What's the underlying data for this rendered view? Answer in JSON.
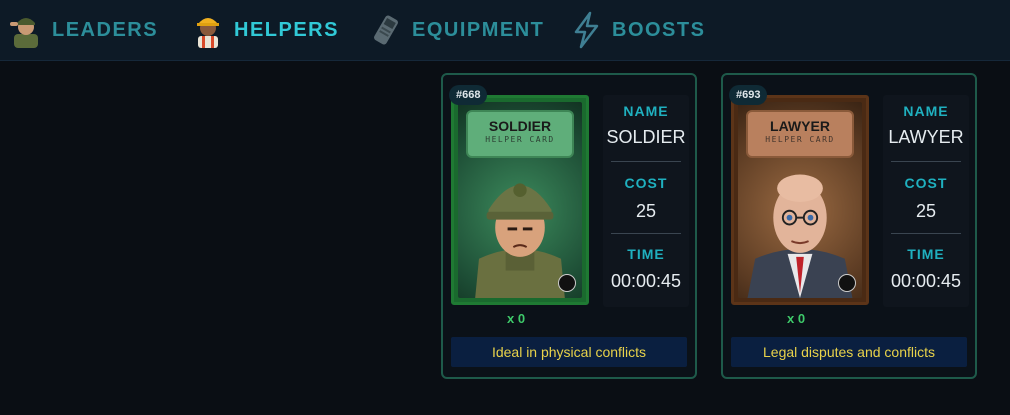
{
  "tabs": [
    {
      "label": "LEADERS",
      "icon": "soldier-leader-icon",
      "active": false
    },
    {
      "label": "HELPERS",
      "icon": "worker-helper-icon",
      "active": true
    },
    {
      "label": "EQUIPMENT",
      "icon": "phone-device-icon",
      "active": false
    },
    {
      "label": "BOOSTS",
      "icon": "lightning-bolt-icon",
      "active": false
    }
  ],
  "cards": [
    {
      "id_label": "#668",
      "art_title": "SOLDIER",
      "art_subtitle": "HELPER CARD",
      "theme": "green",
      "fields": {
        "name_key": "NAME",
        "name_value": "SOLDIER",
        "cost_key": "COST",
        "cost_value": "25",
        "time_key": "TIME",
        "time_value": "00:00:45"
      },
      "quantity": "x 0",
      "description": "Ideal in physical conflicts"
    },
    {
      "id_label": "#693",
      "art_title": "LAWYER",
      "art_subtitle": "HELPER CARD",
      "theme": "brown",
      "fields": {
        "name_key": "NAME",
        "name_value": "LAWYER",
        "cost_key": "COST",
        "cost_value": "25",
        "time_key": "TIME",
        "time_value": "00:00:45"
      },
      "quantity": "x 0",
      "description": "Legal disputes and conflicts"
    }
  ],
  "colors": {
    "accent": "#31c9d6",
    "tab_inactive": "#2c8e9a",
    "quantity": "#3ec96a",
    "description_text": "#e8d24a"
  }
}
